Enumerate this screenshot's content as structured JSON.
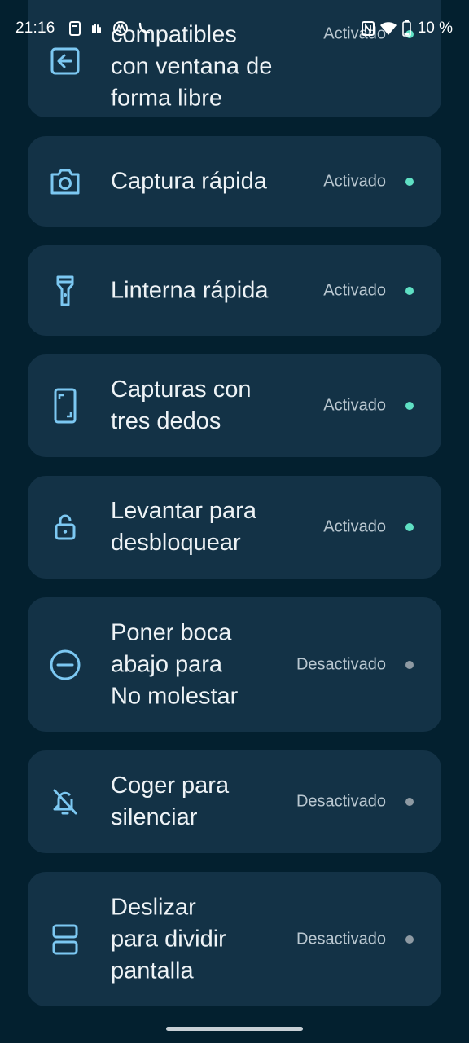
{
  "status_bar": {
    "time": "21:16",
    "battery_text": "10 %"
  },
  "settings": [
    {
      "id": "freeform",
      "title_lines": [
        "compatibles",
        "con ventana de",
        "forma libre"
      ],
      "status": "Activado",
      "enabled": true,
      "icon": "freeform-window-icon"
    },
    {
      "id": "quick-capture",
      "title_lines": [
        "Captura rápida"
      ],
      "status": "Activado",
      "enabled": true,
      "icon": "camera-icon"
    },
    {
      "id": "quick-flashlight",
      "title_lines": [
        "Linterna rápida"
      ],
      "status": "Activado",
      "enabled": true,
      "icon": "flashlight-icon"
    },
    {
      "id": "three-finger",
      "title_lines": [
        "Capturas con",
        "tres dedos"
      ],
      "status": "Activado",
      "enabled": true,
      "icon": "phone-screenshot-icon"
    },
    {
      "id": "lift-unlock",
      "title_lines": [
        "Levantar para",
        "desbloquear"
      ],
      "status": "Activado",
      "enabled": true,
      "icon": "unlock-icon"
    },
    {
      "id": "flip-dnd",
      "title_lines": [
        "Poner boca",
        "abajo para",
        "No molestar"
      ],
      "status": "Desactivado",
      "enabled": false,
      "icon": "do-not-disturb-icon"
    },
    {
      "id": "pickup-silence",
      "title_lines": [
        "Coger para",
        "silenciar"
      ],
      "status": "Desactivado",
      "enabled": false,
      "icon": "bell-off-icon"
    },
    {
      "id": "swipe-split",
      "title_lines": [
        "Deslizar",
        "para dividir",
        "pantalla"
      ],
      "status": "Desactivado",
      "enabled": false,
      "icon": "split-screen-icon"
    }
  ],
  "colors": {
    "background": "#03202f",
    "card": "#133246",
    "icon": "#7cc8f2",
    "enabled_dot": "#5fe0c4",
    "disabled_dot": "#8e9aa3"
  }
}
